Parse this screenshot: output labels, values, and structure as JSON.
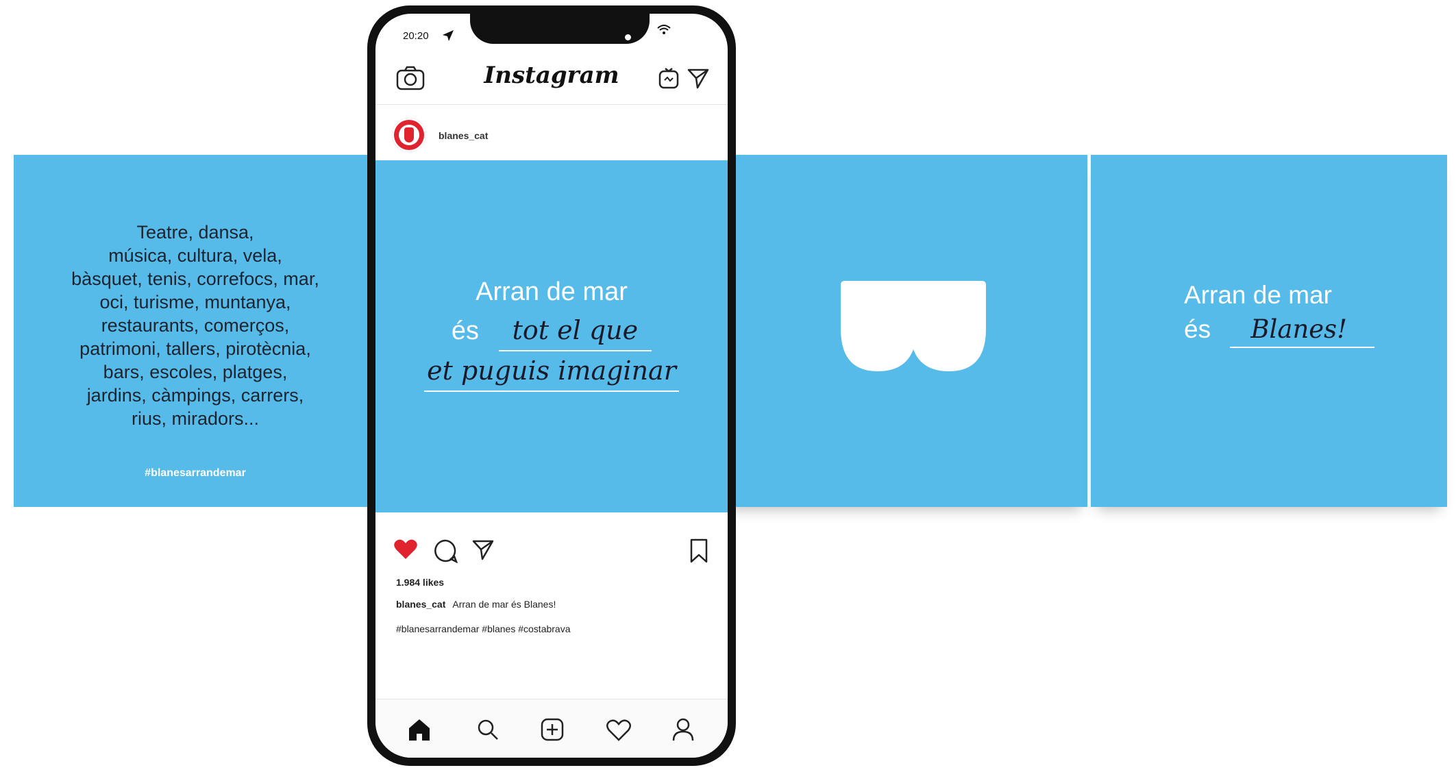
{
  "left_panel": {
    "lines": [
      "Teatre, dansa,",
      "música, cultura, vela,",
      "bàsquet, tenis, correfocs, mar,",
      "oci, turisme, muntanya,",
      "restaurants, comerços,",
      "patrimoni, tallers, pirotècnia,",
      "bars, escoles, platges,",
      "jardins, càmpings, carrers,",
      "rius, miradors..."
    ],
    "hashtag": "#blanesarrandemar"
  },
  "phone": {
    "status_time": "20:20",
    "app_logo": "Instagram",
    "username": "blanes_cat",
    "post": {
      "line1": "Arran de mar",
      "line2_prefix": "és",
      "line2_script": "tot el que",
      "line3_script": "et puguis imaginar"
    },
    "likes": "1.984 likes",
    "caption_user": "blanes_cat",
    "caption_text": "Arran de mar és Blanes!",
    "hashtags": "#blanesarrandemar #blanes #costabrava"
  },
  "right_panel": {
    "line1": "Arran de mar",
    "line2_prefix": "és",
    "line2_script": "Blanes!"
  },
  "colors": {
    "panel_blue": "#56bbe8",
    "heart_red": "#e0242f"
  },
  "icons": [
    "camera-icon",
    "igtv-icon",
    "direct-message-icon",
    "heart-icon",
    "comment-icon",
    "share-icon",
    "bookmark-icon",
    "home-icon",
    "search-icon",
    "add-post-icon",
    "activity-heart-icon",
    "profile-icon"
  ]
}
